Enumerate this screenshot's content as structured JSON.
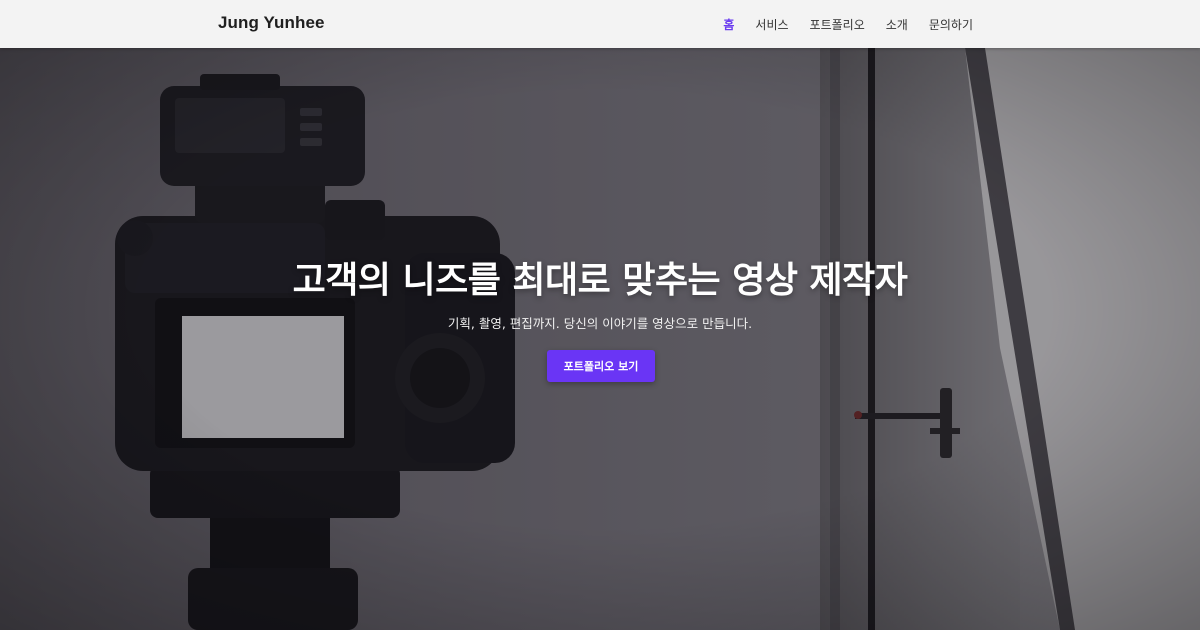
{
  "header": {
    "logo": "Jung Yunhee",
    "nav": [
      {
        "label": "홈",
        "active": true
      },
      {
        "label": "서비스",
        "active": false
      },
      {
        "label": "포트폴리오",
        "active": false
      },
      {
        "label": "소개",
        "active": false
      },
      {
        "label": "문의하기",
        "active": false
      }
    ]
  },
  "hero": {
    "title": "고객의 니즈를 최대로 맞추는 영상 제작자",
    "subtitle": "기획, 촬영, 편집까지. 당신의 이야기를 영상으로 만듭니다.",
    "cta_label": "포트폴리오 보기",
    "background_image": "camera-on-tripod-studio-photo"
  },
  "colors": {
    "accent": "#6a35f5",
    "header_bg": "#f3f3f3",
    "nav_active": "#6a3cf0"
  }
}
